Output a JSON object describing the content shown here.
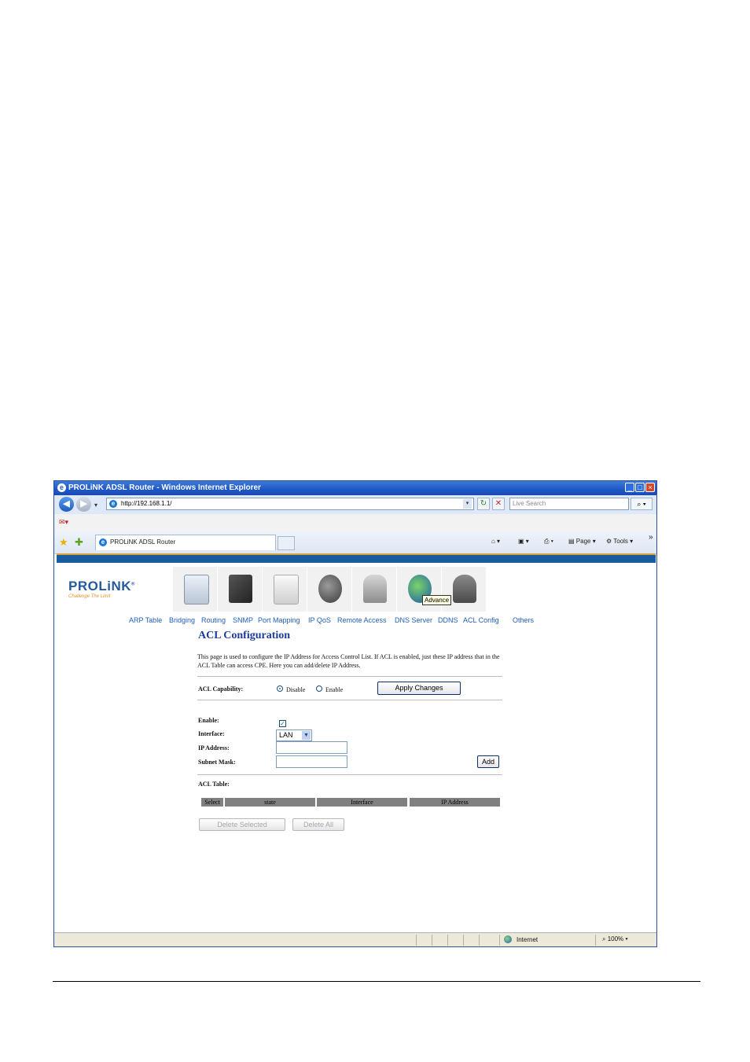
{
  "browser": {
    "title": "PROLiNK ADSL Router - Windows Internet Explorer",
    "address": "http://192.168.1.1/",
    "search_placeholder": "Live Search",
    "tab_label": "PROLiNK ADSL Router",
    "commands": {
      "page": "Page",
      "tools": "Tools"
    },
    "status": {
      "zone": "Internet",
      "zoom": "100%"
    }
  },
  "router": {
    "logo": "PROLiNK",
    "logo_reg": "®",
    "slogan": "Challenge The Limit",
    "tooltip": "Advance",
    "icons": [
      "status-icon",
      "setup-icon",
      "device-icon",
      "globe-network-icon",
      "lock-icon",
      "advance-globe-icon",
      "admin-user-icon"
    ],
    "menu": [
      "ARP Table",
      "Bridging",
      "Routing",
      "SNMP",
      "Port Mapping",
      "IP QoS",
      "Remote Access",
      "DNS Server",
      "DDNS",
      "ACL Config",
      "Others"
    ]
  },
  "page": {
    "title": "ACL Configuration",
    "description": "This page is used to configure the IP Address for Access Control List. If ACL is enabled, just these IP address that in the ACL Table can access CPE. Here you can add/delete IP Address.",
    "acl_capability": {
      "label": "ACL Capability:",
      "options": [
        "Disable",
        "Enable"
      ],
      "selected": "Disable",
      "apply_label": "Apply Changes"
    },
    "form": {
      "enable_label": "Enable:",
      "enable_checked": true,
      "interface_label": "Interface:",
      "interface_value": "LAN",
      "ip_label": "IP Address:",
      "ip_value": "",
      "mask_label": "Subnet Mask:",
      "mask_value": "",
      "add_label": "Add"
    },
    "table": {
      "title": "ACL Table:",
      "headers": [
        "Select",
        "state",
        "Interface",
        "IP Address"
      ]
    },
    "buttons": {
      "delete_selected": "Delete Selected",
      "delete_all": "Delete All"
    }
  }
}
